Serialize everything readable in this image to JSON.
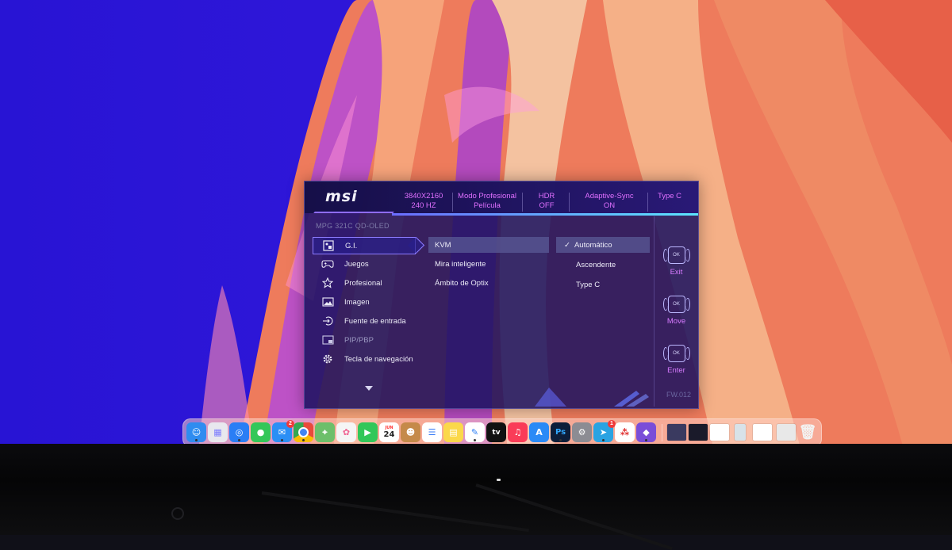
{
  "osd": {
    "brand": "msi",
    "model": "MPG 321C QD-OLED",
    "status": [
      {
        "line1": "3840X2160",
        "line2": "240 HZ"
      },
      {
        "line1": "Modo Profesional",
        "line2": "Película"
      },
      {
        "line1": "HDR",
        "line2": "OFF"
      },
      {
        "line1": "Adaptive-Sync",
        "line2": "ON"
      },
      {
        "line1": "Type C",
        "line2": ""
      }
    ],
    "menu": [
      {
        "label": "G.I.",
        "icon": "gi-icon"
      },
      {
        "label": "Juegos",
        "icon": "gamepad-icon"
      },
      {
        "label": "Profesional",
        "icon": "star-icon"
      },
      {
        "label": "Imagen",
        "icon": "image-icon"
      },
      {
        "label": "Fuente de entrada",
        "icon": "input-source-icon"
      },
      {
        "label": "PIP/PBP",
        "icon": "pip-icon"
      },
      {
        "label": "Tecla de navegación",
        "icon": "gear-icon"
      }
    ],
    "submenu": [
      {
        "label": "KVM"
      },
      {
        "label": "Mira inteligente"
      },
      {
        "label": "Ámbito de Optix"
      }
    ],
    "options": [
      {
        "label": "Automático",
        "checked": true
      },
      {
        "label": "Ascendente",
        "checked": false
      },
      {
        "label": "Type C",
        "checked": false
      }
    ],
    "controls": [
      {
        "label": "Exit",
        "knob": "OK"
      },
      {
        "label": "Move",
        "knob": "OK"
      },
      {
        "label": "Enter",
        "knob": "OK"
      }
    ],
    "firmware": "FW.012",
    "accent": "#d77bff"
  },
  "dock": {
    "apps": [
      {
        "name": "finder",
        "glyph": "☺",
        "color": "#2f8cf0"
      },
      {
        "name": "launchpad",
        "glyph": "▦",
        "color": "#e8e8ee"
      },
      {
        "name": "safari",
        "glyph": "◎",
        "color": "#2a7ef5"
      },
      {
        "name": "messages",
        "glyph": "●",
        "color": "#34c759"
      },
      {
        "name": "mail",
        "glyph": "✉",
        "color": "#2b8ff5",
        "badge": "2"
      },
      {
        "name": "chrome",
        "glyph": "◉",
        "color": "#e94a3b"
      },
      {
        "name": "maps",
        "glyph": "⌖",
        "color": "#6dbf6a"
      },
      {
        "name": "photos",
        "glyph": "✿",
        "color": "#f5f5f5"
      },
      {
        "name": "facetime",
        "glyph": "▶",
        "color": "#32c759"
      },
      {
        "name": "calendar",
        "glyph": "24",
        "color": "#ffffff",
        "sub": "JUN"
      },
      {
        "name": "contacts",
        "glyph": "☻",
        "color": "#c58a4a"
      },
      {
        "name": "reminders",
        "glyph": "☰",
        "color": "#ffffff"
      },
      {
        "name": "notes",
        "glyph": "▤",
        "color": "#fbd84a"
      },
      {
        "name": "freeform",
        "glyph": "✎",
        "color": "#ffffff"
      },
      {
        "name": "tv",
        "glyph": "tv",
        "color": "#111111"
      },
      {
        "name": "music",
        "glyph": "♫",
        "color": "#fa3c58"
      },
      {
        "name": "app-store",
        "glyph": "A",
        "color": "#2a8af6"
      },
      {
        "name": "photoshop",
        "glyph": "Ps",
        "color": "#0d1e3a"
      },
      {
        "name": "system-settings",
        "glyph": "⚙",
        "color": "#8c8c93"
      },
      {
        "name": "telegram",
        "glyph": "➤",
        "color": "#2aa3e2",
        "badge": "1"
      },
      {
        "name": "scrobbles",
        "glyph": "⁂",
        "color": "#ffffff"
      },
      {
        "name": "obsidian",
        "glyph": "◆",
        "color": "#7a4dd8"
      }
    ]
  }
}
